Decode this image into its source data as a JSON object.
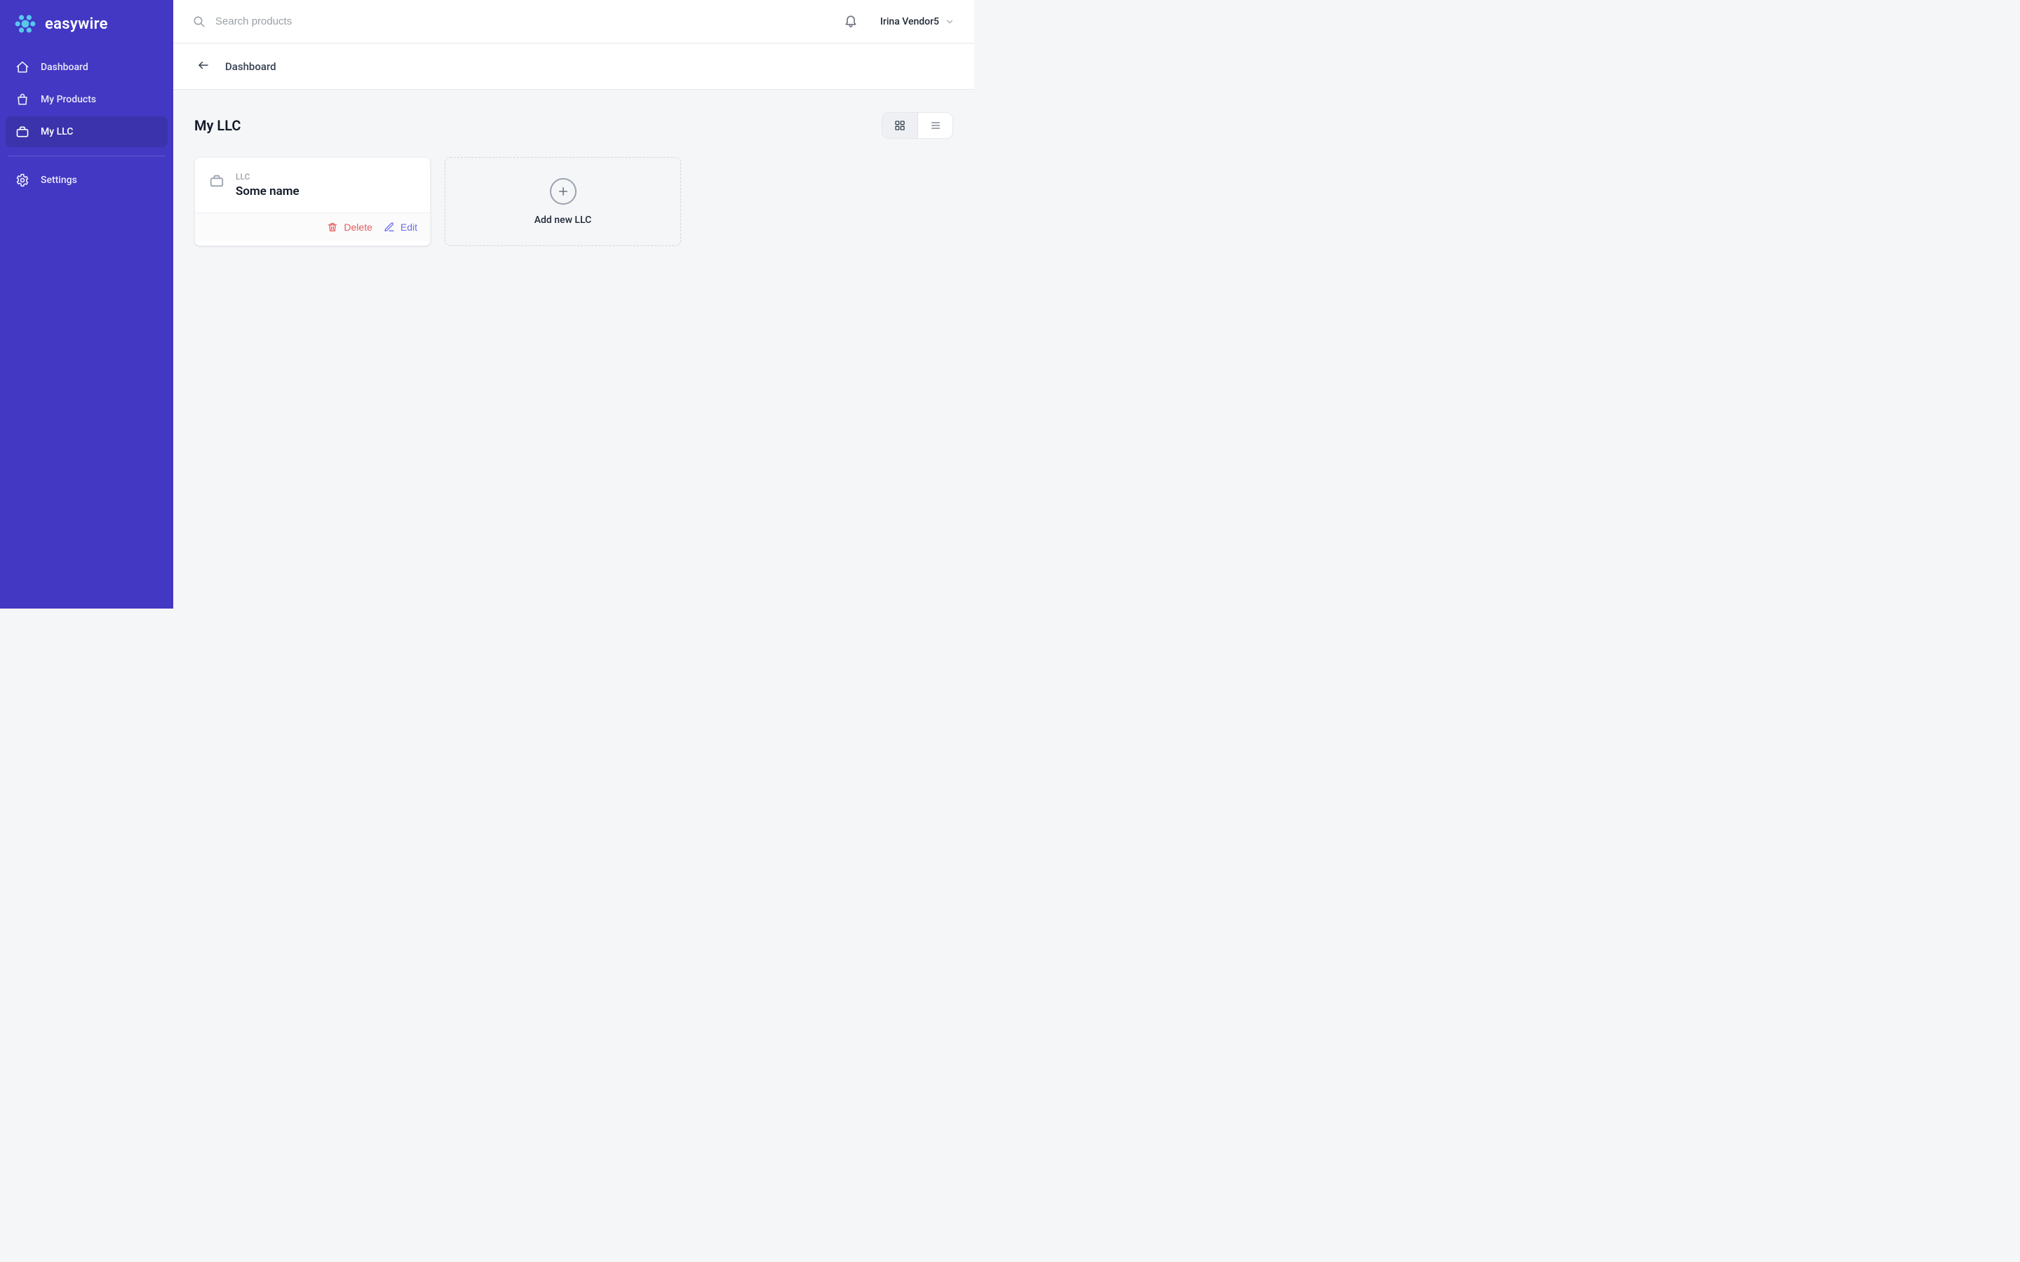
{
  "brand": {
    "name": "easywire"
  },
  "sidebar": {
    "items": [
      {
        "label": "Dashboard"
      },
      {
        "label": "My Products"
      },
      {
        "label": "My LLC"
      },
      {
        "label": "Settings"
      }
    ]
  },
  "header": {
    "search_placeholder": "Search products",
    "user_name": "Irina Vendor5"
  },
  "breadcrumb": {
    "back_label": "Dashboard"
  },
  "page": {
    "title": "My LLC",
    "llc_list": [
      {
        "type_label": "LLC",
        "name": "Some name"
      }
    ],
    "actions": {
      "delete": "Delete",
      "edit": "Edit"
    },
    "add_label": "Add new LLC"
  }
}
